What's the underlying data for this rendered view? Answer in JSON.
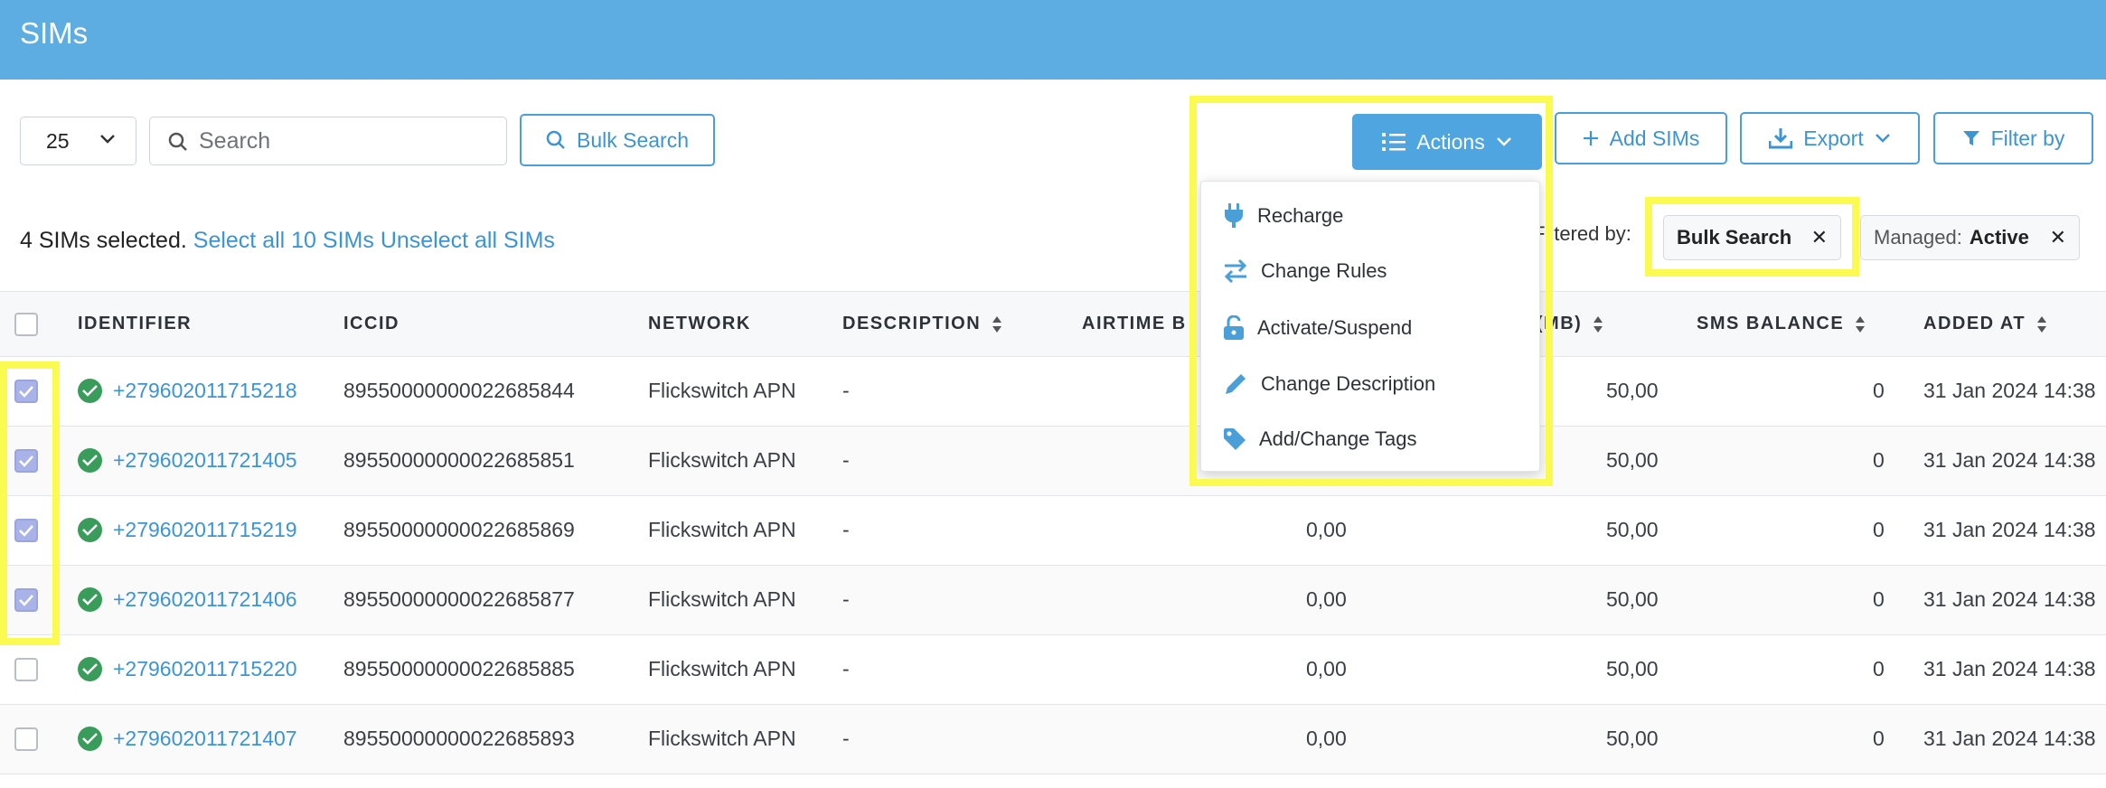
{
  "header": {
    "title": "SIMs"
  },
  "toolbar": {
    "page_size": "25",
    "search_placeholder": "Search",
    "bulk_search_label": "Bulk Search",
    "actions_label": "Actions",
    "add_sims_label": "Add SIMs",
    "export_label": "Export",
    "filter_label": "Filter by"
  },
  "selection": {
    "text": "4 SIMs selected.",
    "select_all": "Select all 10 SIMs",
    "unselect_all": "Unselect all SIMs"
  },
  "filters": {
    "label": "Filtered by:",
    "chips": [
      {
        "name": "",
        "value": "Bulk Search"
      },
      {
        "name": "Managed:",
        "value": "Active"
      }
    ]
  },
  "actions_menu": {
    "items": [
      {
        "label": "Recharge",
        "icon": "plug-icon"
      },
      {
        "label": "Change Rules",
        "icon": "swap-arrows-icon"
      },
      {
        "label": "Activate/Suspend",
        "icon": "unlock-icon"
      },
      {
        "label": "Change Description",
        "icon": "pencil-icon"
      },
      {
        "label": "Add/Change Tags",
        "icon": "tag-icon"
      }
    ]
  },
  "table": {
    "columns": [
      "IDENTIFIER",
      "ICCID",
      "NETWORK",
      "DESCRIPTION",
      "AIRTIME B",
      "E (MB)",
      "SMS BALANCE",
      "ADDED AT"
    ],
    "rows": [
      {
        "identifier": "+279602011715218",
        "iccid": "89550000000022685844",
        "network": "Flickswitch APN",
        "description": "-",
        "airtime": "",
        "data": "50,00",
        "sms": "0",
        "added": "31 Jan 2024 14:38",
        "checked": true
      },
      {
        "identifier": "+279602011721405",
        "iccid": "89550000000022685851",
        "network": "Flickswitch APN",
        "description": "-",
        "airtime": "",
        "data": "50,00",
        "sms": "0",
        "added": "31 Jan 2024 14:38",
        "checked": true
      },
      {
        "identifier": "+279602011715219",
        "iccid": "89550000000022685869",
        "network": "Flickswitch APN",
        "description": "-",
        "airtime": "0,00",
        "data": "50,00",
        "sms": "0",
        "added": "31 Jan 2024 14:38",
        "checked": true
      },
      {
        "identifier": "+279602011721406",
        "iccid": "89550000000022685877",
        "network": "Flickswitch APN",
        "description": "-",
        "airtime": "0,00",
        "data": "50,00",
        "sms": "0",
        "added": "31 Jan 2024 14:38",
        "checked": true
      },
      {
        "identifier": "+279602011715220",
        "iccid": "89550000000022685885",
        "network": "Flickswitch APN",
        "description": "-",
        "airtime": "0,00",
        "data": "50,00",
        "sms": "0",
        "added": "31 Jan 2024 14:38",
        "checked": false
      },
      {
        "identifier": "+279602011721407",
        "iccid": "89550000000022685893",
        "network": "Flickswitch APN",
        "description": "-",
        "airtime": "0,00",
        "data": "50,00",
        "sms": "0",
        "added": "31 Jan 2024 14:38",
        "checked": false
      }
    ]
  },
  "colors": {
    "header_bg": "#5dade2",
    "accent": "#3b95d5",
    "highlight": "#fafa50",
    "status_active": "#3a9c5a",
    "checkbox_checked": "#aab3e8"
  }
}
